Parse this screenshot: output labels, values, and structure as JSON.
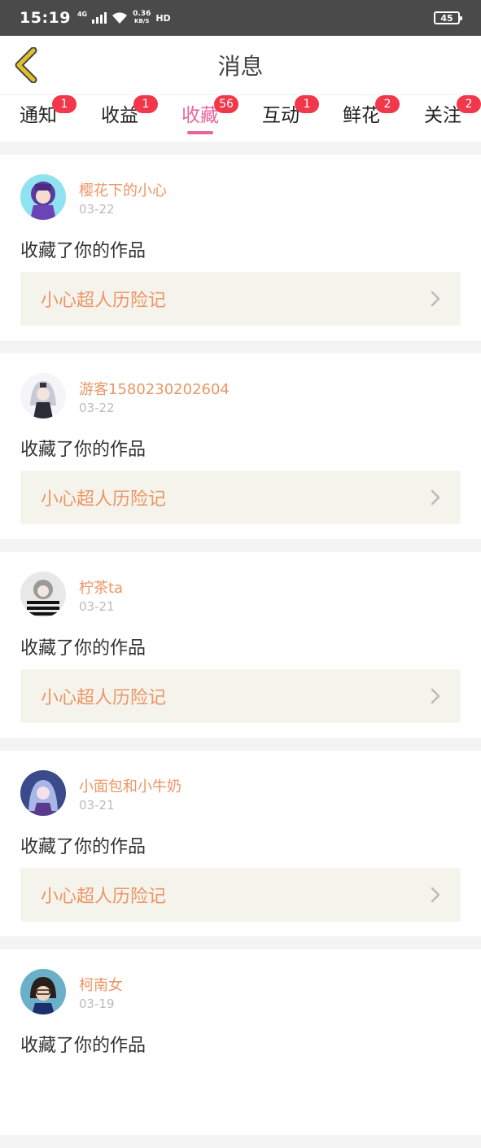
{
  "status_bar": {
    "time": "15:19",
    "network": "4G",
    "speed_top": "0.36",
    "speed_unit": "KB/S",
    "hd": "HD",
    "battery": "45"
  },
  "header": {
    "title": "消息"
  },
  "tabs": [
    {
      "label": "通知",
      "badge": "1",
      "active": false
    },
    {
      "label": "收益",
      "badge": "1",
      "active": false
    },
    {
      "label": "收藏",
      "badge": "56",
      "active": true
    },
    {
      "label": "互动",
      "badge": "1",
      "active": false
    },
    {
      "label": "鲜花",
      "badge": "2",
      "active": false
    },
    {
      "label": "关注",
      "badge": "2",
      "active": false
    }
  ],
  "messages": [
    {
      "user": "樱花下的小心",
      "date": "03-22",
      "action": "收藏了你的作品",
      "work": "小心超人历险记",
      "avatar": "anime-avatar-purple"
    },
    {
      "user": "游客1580230202604",
      "date": "03-22",
      "action": "收藏了你的作品",
      "work": "小心超人历险记",
      "avatar": "anime-avatar-silver"
    },
    {
      "user": "柠茶ta",
      "date": "03-21",
      "action": "收藏了你的作品",
      "work": "小心超人历险记",
      "avatar": "anime-avatar-striped"
    },
    {
      "user": "小面包和小牛奶",
      "date": "03-21",
      "action": "收藏了你的作品",
      "work": "小心超人历险记",
      "avatar": "anime-avatar-blue"
    },
    {
      "user": "柯南女",
      "date": "03-19",
      "action": "收藏了你的作品",
      "work": "",
      "avatar": "anime-avatar-conan"
    }
  ],
  "colors": {
    "accent_pink": "#e8679b",
    "name_orange": "#ec9566",
    "badge_red": "#f0384a",
    "back_arrow": "#e3c02a"
  }
}
